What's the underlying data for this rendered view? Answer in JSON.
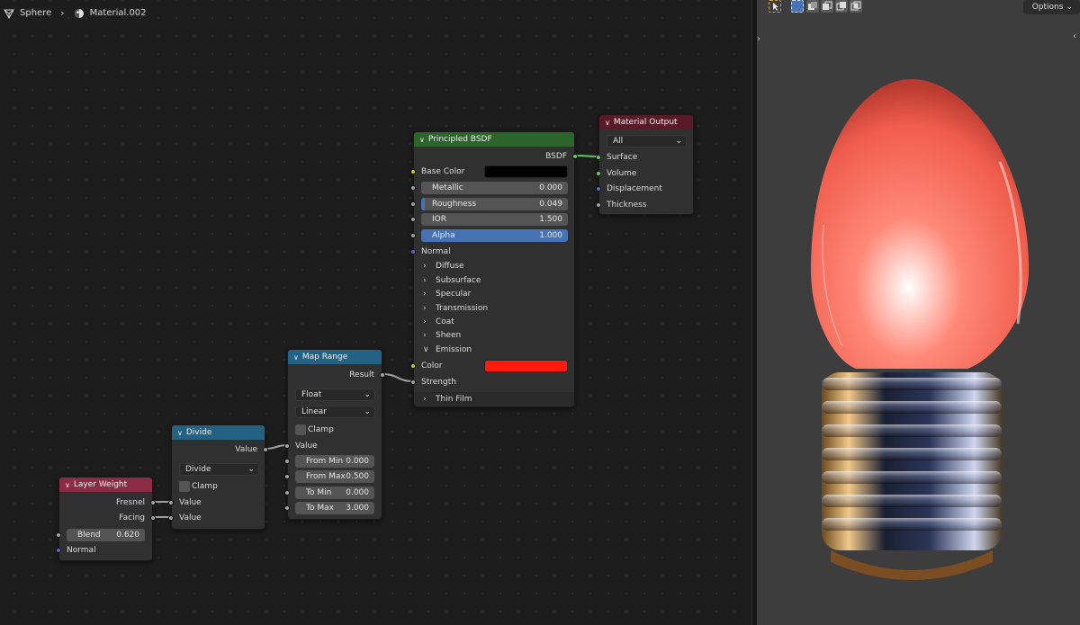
{
  "breadcrumb": {
    "object": "Sphere",
    "material": "Material.002"
  },
  "viewport": {
    "options_label": "Options"
  },
  "colors": {
    "layer_weight": "#8a2c46",
    "converter": "#246283",
    "shader": "#2b652b",
    "output": "#5a1a27",
    "emission_color": "#ff1a0d",
    "base_color": "#000000"
  },
  "nodes": {
    "layer_weight": {
      "title": "Layer Weight",
      "out_fresnel": "Fresnel",
      "out_facing": "Facing",
      "blend_label": "Blend",
      "blend_value": "0.620",
      "normal_label": "Normal"
    },
    "divide": {
      "title": "Divide",
      "out_value": "Value",
      "operation": "Divide",
      "clamp_label": "Clamp",
      "in_value_1": "Value",
      "in_value_2": "Value"
    },
    "map_range": {
      "title": "Map Range",
      "out_result": "Result",
      "data_type": "Float",
      "interpolation": "Linear",
      "clamp_label": "Clamp",
      "in_value": "Value",
      "from_min_label": "From Min",
      "from_min_value": "0.000",
      "from_max_label": "From Max",
      "from_max_value": "0.500",
      "to_min_label": "To Min",
      "to_min_value": "0.000",
      "to_max_label": "To Max",
      "to_max_value": "3.000"
    },
    "principled": {
      "title": "Principled BSDF",
      "out_bsdf": "BSDF",
      "base_color_label": "Base Color",
      "metallic_label": "Metallic",
      "metallic_value": "0.000",
      "roughness_label": "Roughness",
      "roughness_value": "0.049",
      "ior_label": "IOR",
      "ior_value": "1.500",
      "alpha_label": "Alpha",
      "alpha_value": "1.000",
      "normal_label": "Normal",
      "panels": [
        "Diffuse",
        "Subsurface",
        "Specular",
        "Transmission",
        "Coat",
        "Sheen"
      ],
      "emission_label": "Emission",
      "color_label": "Color",
      "strength_label": "Strength",
      "thin_film_label": "Thin Film"
    },
    "material_output": {
      "title": "Material Output",
      "target": "All",
      "surface_label": "Surface",
      "volume_label": "Volume",
      "displacement_label": "Displacement",
      "thickness_label": "Thickness"
    }
  }
}
